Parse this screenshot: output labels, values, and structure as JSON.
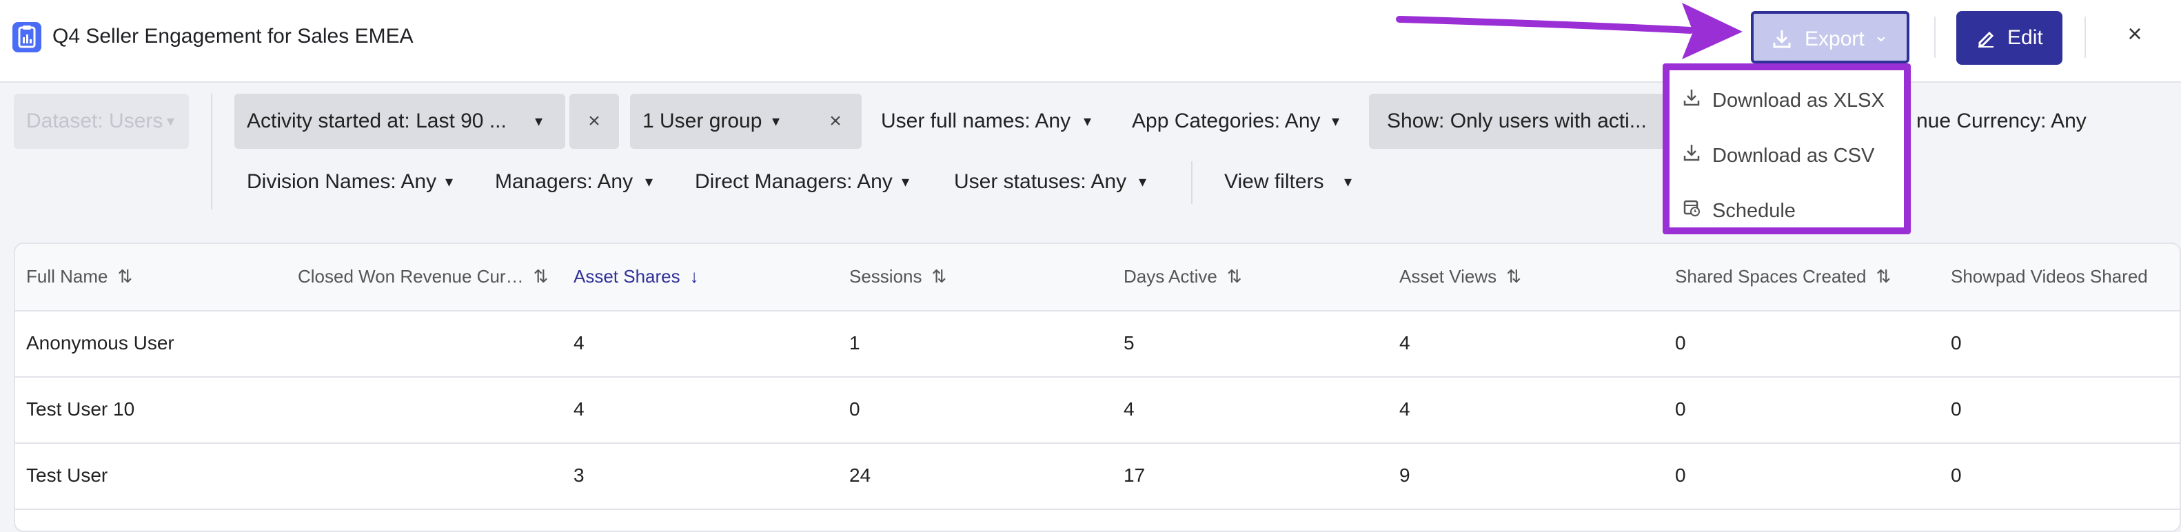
{
  "header": {
    "title": "Q4 Seller Engagement for Sales EMEA",
    "export_label": "Export",
    "edit_label": "Edit",
    "close_glyph": "×"
  },
  "export_menu": {
    "items": [
      {
        "label": "Download as XLSX",
        "icon": "download-icon"
      },
      {
        "label": "Download as CSV",
        "icon": "download-icon"
      },
      {
        "label": "Schedule",
        "icon": "calendar-clock-icon"
      }
    ]
  },
  "filters": {
    "dataset": "Dataset: Users",
    "activity": "Activity started at: Last 90 ...",
    "user_group": "1 User group",
    "user_full_names": "User full names: Any",
    "app_categories": "App Categories: Any",
    "show": "Show: Only users with acti...",
    "revenue_currency_partial": "nue Currency: Any",
    "division_names": "Division Names: Any",
    "managers": "Managers: Any",
    "direct_managers": "Direct Managers: Any",
    "user_statuses": "User statuses: Any",
    "view_filters": "View filters"
  },
  "table": {
    "columns": [
      "Full Name",
      "Closed Won Revenue Cur…",
      "Asset Shares",
      "Sessions",
      "Days Active",
      "Asset Views",
      "Shared Spaces Created",
      "Showpad Videos Shared"
    ],
    "sorted_column": "Asset Shares",
    "rows": [
      [
        "Anonymous User",
        "",
        "4",
        "1",
        "5",
        "4",
        "0",
        "0"
      ],
      [
        "Test User 10",
        "",
        "4",
        "0",
        "4",
        "4",
        "0",
        "0"
      ],
      [
        "Test User",
        "",
        "3",
        "24",
        "17",
        "9",
        "0",
        "0"
      ]
    ]
  },
  "colors": {
    "accent": "#30319b",
    "annotation": "#9b2fd6",
    "export_disabled": "#c5c8ec"
  }
}
